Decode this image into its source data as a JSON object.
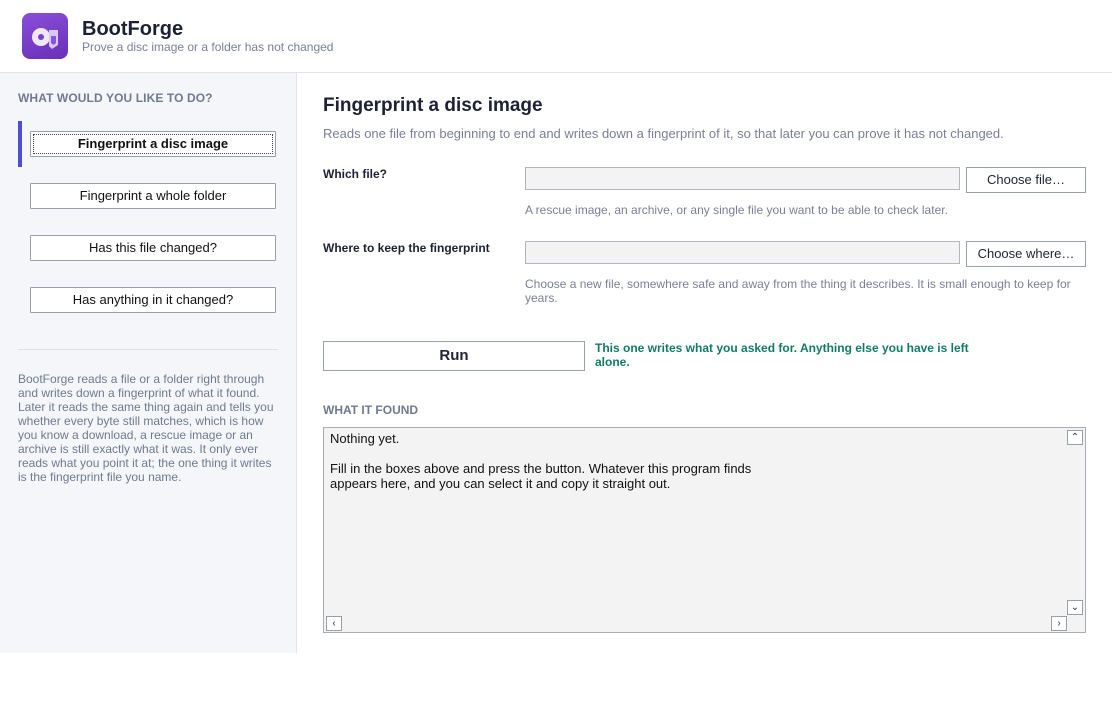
{
  "app": {
    "title": "BootForge",
    "subtitle": "Prove a disc image or a folder has not changed",
    "icon": "disc-shield-icon",
    "accent": "#6a2fb8"
  },
  "sidebar": {
    "heading": "WHAT WOULD YOU LIKE TO DO?",
    "items": [
      {
        "label": "Fingerprint a disc image",
        "active": true
      },
      {
        "label": "Fingerprint a whole folder",
        "active": false
      },
      {
        "label": "Has this file changed?",
        "active": false
      },
      {
        "label": "Has anything in it changed?",
        "active": false
      }
    ],
    "about": "BootForge reads a file or a folder right through and writes down a fingerprint of what it found. Later it reads the same thing again and tells you whether every byte still matches, which is how you know a download, a rescue image or an archive is still exactly what it was. It only ever reads what you point it at; the one thing it writes is the fingerprint file you name.",
    "active_color": "#4a4fd6"
  },
  "main": {
    "title": "Fingerprint a disc image",
    "description": "Reads one file from beginning to end and writes down a fingerprint of it, so that later you can prove it has not changed.",
    "fields": [
      {
        "label": "Which file?",
        "value": "",
        "button": "Choose file…",
        "hint": "A rescue image, an archive, or any single file you want to be able to check later."
      },
      {
        "label": "Where to keep the fingerprint",
        "value": "",
        "button": "Choose where…",
        "hint": "Choose a new file, somewhere safe and away from the thing it describes. It is small enough to keep for years."
      }
    ],
    "run_label": "Run",
    "run_note": "This one writes what you asked for. Anything else you have is left alone.",
    "run_note_color": "#137a6a",
    "output_heading": "WHAT IT FOUND",
    "output_text": "Nothing yet.\n\nFill in the boxes above and press the button. Whatever this program finds\nappears here, and you can select it and copy it straight out."
  }
}
